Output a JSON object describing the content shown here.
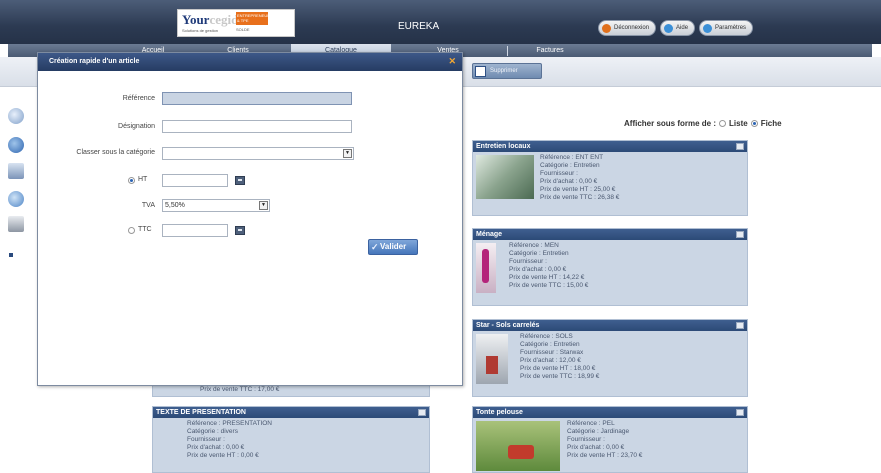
{
  "header": {
    "logo_brand_bold": "Your",
    "logo_brand_light": "cegid",
    "logo_tagline": "Solutions de gestion",
    "logo_badge": "ENTREPRENEURS & TPE",
    "logo_badge_sub": "SOLDE",
    "app_title": "EUREKA",
    "buttons": [
      {
        "label": "Déconnexion",
        "icon": "power-icon",
        "color": "#e0701c"
      },
      {
        "label": "Aide",
        "icon": "help-icon",
        "color": "#3b8fd6"
      },
      {
        "label": "Paramètres",
        "icon": "settings-icon",
        "color": "#3b8fd6"
      }
    ]
  },
  "nav": {
    "tabs": [
      "Accueil",
      "Clients",
      "Catalogue",
      "Ventes",
      "Factures"
    ],
    "active_tab": "Catalogue"
  },
  "toolbar": {
    "supprimer_label": "Supprimer"
  },
  "view_selector": {
    "label": "Afficher sous forme de :",
    "options": [
      "Liste",
      "Fiche"
    ],
    "selected": "Fiche"
  },
  "modal": {
    "title": "Création rapide d'un article",
    "fields": {
      "reference_label": "Référence",
      "reference_value": "",
      "designation_label": "Désignation",
      "designation_value": "",
      "category_label": "Classer sous la catégorie",
      "category_value": "",
      "ht_label": "HT",
      "ht_value": "",
      "tva_label": "TVA",
      "tva_value": "5,50%",
      "ttc_label": "TTC",
      "ttc_value": ""
    },
    "price_mode": "HT",
    "submit_label": "Valider"
  },
  "cards": [
    {
      "title": "Entretien locaux",
      "lines": [
        "Référence : ENT ENT",
        "Catégorie : Entretien",
        "Fournisseur :",
        "Prix d'achat : 0,00 €",
        "Prix de vente HT : 25,00 €",
        "Prix de vente TTC : 26,38 €"
      ]
    },
    {
      "title": "Ménage",
      "lines": [
        "Référence : MEN",
        "Catégorie : Entretien",
        "Fournisseur :",
        "Prix d'achat : 0,00 €",
        "Prix de vente HT : 14,22 €",
        "Prix de vente TTC : 15,00 €"
      ]
    },
    {
      "title": "Star - Sols carrelés",
      "lines": [
        "Référence : SOLS",
        "Catégorie : Entretien",
        "Fournisseur : Starwax",
        "Prix d'achat : 12,00 €",
        "Prix de vente HT : 18,00 €",
        "Prix de vente TTC : 18,99 €"
      ]
    },
    {
      "title": "Tonte pelouse",
      "lines": [
        "Référence : PEL",
        "Catégorie : Jardinage",
        "Fournisseur :",
        "Prix d'achat : 0,00 €",
        "Prix de vente HT : 23,70 €"
      ]
    },
    {
      "title": "TEXTE DE PRESENTATION",
      "lines": [
        "Référence : PRESENTATION",
        "Catégorie : divers",
        "Fournisseur :",
        "Prix d'achat : 0,00 €",
        "Prix de vente HT : 0,00 €"
      ]
    }
  ],
  "hidden_card_line": "Prix de vente TTC : 17,00 €"
}
